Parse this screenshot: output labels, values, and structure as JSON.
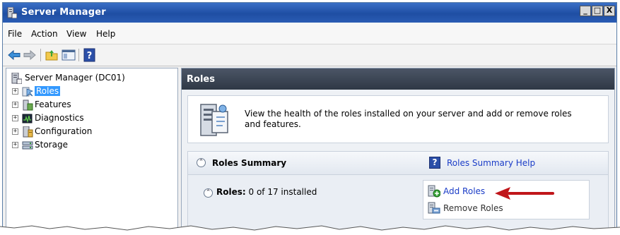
{
  "window": {
    "title": "Server Manager",
    "caption_buttons": [
      "_",
      "□",
      "X"
    ]
  },
  "menu": [
    "File",
    "Action",
    "View",
    "Help"
  ],
  "toolbar": {
    "icons": [
      "back-arrow-icon",
      "forward-arrow-icon",
      "up-folder-icon",
      "show-hide-tree-icon",
      "help-icon"
    ]
  },
  "tree": {
    "root": "Server Manager (DC01)",
    "items": [
      {
        "label": "Roles",
        "selected": true
      },
      {
        "label": "Features"
      },
      {
        "label": "Diagnostics"
      },
      {
        "label": "Configuration"
      },
      {
        "label": "Storage"
      }
    ]
  },
  "content": {
    "header": "Roles",
    "intro_text": "View the health of the roles installed on your server and add or remove roles and features.",
    "summary": {
      "title": "Roles Summary",
      "help_link": "Roles Summary Help",
      "help_icon_glyph": "?",
      "roles_label": "Roles:",
      "roles_value": "0 of 17 installed",
      "actions": [
        {
          "label": "Add Roles",
          "link": true
        },
        {
          "label": "Remove Roles",
          "link": false
        }
      ]
    }
  },
  "colors": {
    "title_bar": "#1f4ea3",
    "content_header": "#3b4452",
    "link": "#1a3cc7",
    "selection": "#3399ff",
    "annotation_arrow": "#c0161a"
  }
}
